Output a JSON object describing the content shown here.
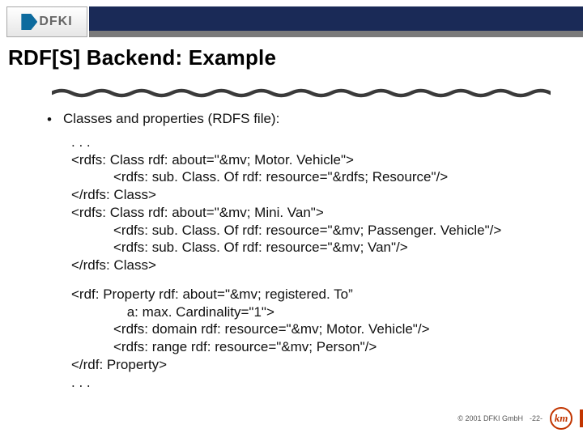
{
  "logo": {
    "text": "DFKI"
  },
  "title": "RDF[S] Backend: Example",
  "content": {
    "bullet_lead": "Classes and properties (RDFS file):",
    "block1": {
      "l0": ". . .",
      "l1": "<rdfs: Class rdf: about=\"&mv; Motor. Vehicle\">",
      "l2": "<rdfs: sub. Class. Of rdf: resource=\"&rdfs; Resource\"/>",
      "l3": "</rdfs: Class>",
      "l4": "<rdfs: Class rdf: about=\"&mv; Mini. Van\">",
      "l5": "<rdfs: sub. Class. Of rdf: resource=\"&mv; Passenger. Vehicle\"/>",
      "l6": "<rdfs: sub. Class. Of rdf: resource=\"&mv; Van\"/>",
      "l7": "</rdfs: Class>"
    },
    "block2": {
      "l1": "<rdf: Property rdf: about=\"&mv; registered. To”",
      "l2": " a: max. Cardinality=\"1\">",
      "l3": "<rdfs: domain rdf: resource=\"&mv; Motor. Vehicle\"/>",
      "l4": "<rdfs: range rdf: resource=\"&mv; Person\"/>",
      "l5": "</rdf: Property>",
      "l6": ". . ."
    }
  },
  "footer": {
    "copyright": "© 2001 DFKI GmbH",
    "page": "-22-",
    "badge": "km"
  }
}
